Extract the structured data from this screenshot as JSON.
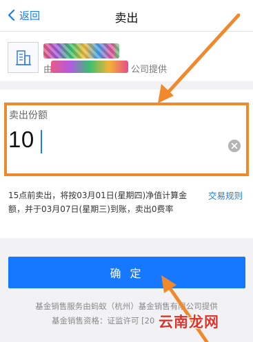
{
  "header": {
    "back_label": "返回",
    "title": "卖出"
  },
  "fund": {
    "icon": "building-icon",
    "provider_prefix": "由",
    "provider_suffix": "公司提供"
  },
  "sell_form": {
    "label": "卖出份额",
    "value": "10",
    "clear_icon": "clear-icon"
  },
  "notice": {
    "text": "15点前卖出，将按03月01日(星期四)净值计算金额，并于03月07日(星期三)到账，卖出0费率",
    "rules_link": "交易规则"
  },
  "confirm_button": "确 定",
  "footer": {
    "line1": "基金销售服务由蚂蚁（杭州）基金销售有限公司提供",
    "line2": "基金销售资格：证监许可 [20"
  },
  "watermark": "云南龙网",
  "colors": {
    "accent": "#1677ff",
    "link": "#1a7cf0",
    "annotation": "#f0892c"
  }
}
